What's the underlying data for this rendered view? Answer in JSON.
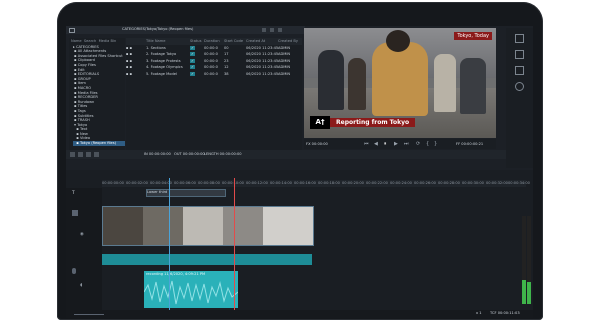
{
  "library": {
    "breadcrumb": "CATEGORIES/Tokyo/Tokyo (Reopen files)",
    "folder_header": [
      "Name",
      "Search",
      "Media Bin"
    ],
    "folders": [
      "CATEGORIES",
      "All Attachments",
      "Associated Files Shortcut",
      "Clipboard",
      "Copy Files",
      "Edit",
      "EDITORIALS",
      "GROUP",
      "Item",
      "MACRO",
      "Media Files",
      "RECORDER",
      "Rundown",
      "Titles",
      "Tags",
      "Subtitles",
      "TRASH",
      "Tokyo",
      "Text",
      "New",
      "Video",
      "Tokyo (Reopen files)"
    ],
    "columns": [
      "Title Name",
      "Status",
      "Duration",
      "Start Code",
      "Created At",
      "Created By"
    ],
    "rows": [
      {
        "title": "1. Sections",
        "status": "✓",
        "duration": "00:00:0",
        "start": "00",
        "created": "06/2020 11:23:45",
        "by": "ADMIN"
      },
      {
        "title": "2. Footage Tokyo",
        "status": "✓",
        "duration": "00:00:0",
        "start": "17",
        "created": "06/2020 11:23:45",
        "by": "ADMIN"
      },
      {
        "title": "3. Footage Protests",
        "status": "✓",
        "duration": "00:00:0",
        "start": "23",
        "created": "06/2020 11:23:45",
        "by": "ADMIN"
      },
      {
        "title": "4. Footage Olympics",
        "status": "✓",
        "duration": "00:00:0",
        "start": "12",
        "created": "06/2020 11:23:45",
        "by": "ADMIN"
      },
      {
        "title": "5. Footage Model",
        "status": "✓",
        "duration": "00:00:0",
        "start": "38",
        "created": "06/2020 11:23:45",
        "by": "ADMIN"
      }
    ]
  },
  "preview": {
    "overlay_top": "Tokyo, Today",
    "logo_text": "A†",
    "lower_third": "Reporting from Tokyo",
    "timecode_left": "FX 00:00:00",
    "timecode_right": "FF 00:00:00:21"
  },
  "timeline": {
    "toolbar_in": "IN 00:00:00:00",
    "toolbar_out": "OUT 00:00:00:00",
    "toolbar_dur": "LENGTH 00:00:00:00",
    "ruler_ticks": [
      "00:00:00:00",
      "00:00:02:00",
      "00:00:04:00",
      "00:00:06:00",
      "00:00:08:00",
      "00:00:10:00",
      "00:00:12:00",
      "00:00:14:00",
      "00:00:16:00",
      "00:00:18:00",
      "00:00:20:00",
      "00:00:22:00",
      "00:00:24:00",
      "00:00:26:00",
      "00:00:28:00",
      "00:00:30:00",
      "00:00:32:00",
      "00:00:34:00"
    ],
    "title_clip": "Lower third",
    "audio_clip_label": "recording 11/6/2020, 4:09:21 PM",
    "footer_left": "",
    "footer_right": "TCF 00:00:11:03",
    "zoom": "x 1"
  },
  "colors": {
    "accent": "#2f5d84",
    "status": "#1f7f8e",
    "audio": "#2ab1b9",
    "playhead": "#4aa3d8",
    "lower_third": "#8b1a1a"
  }
}
